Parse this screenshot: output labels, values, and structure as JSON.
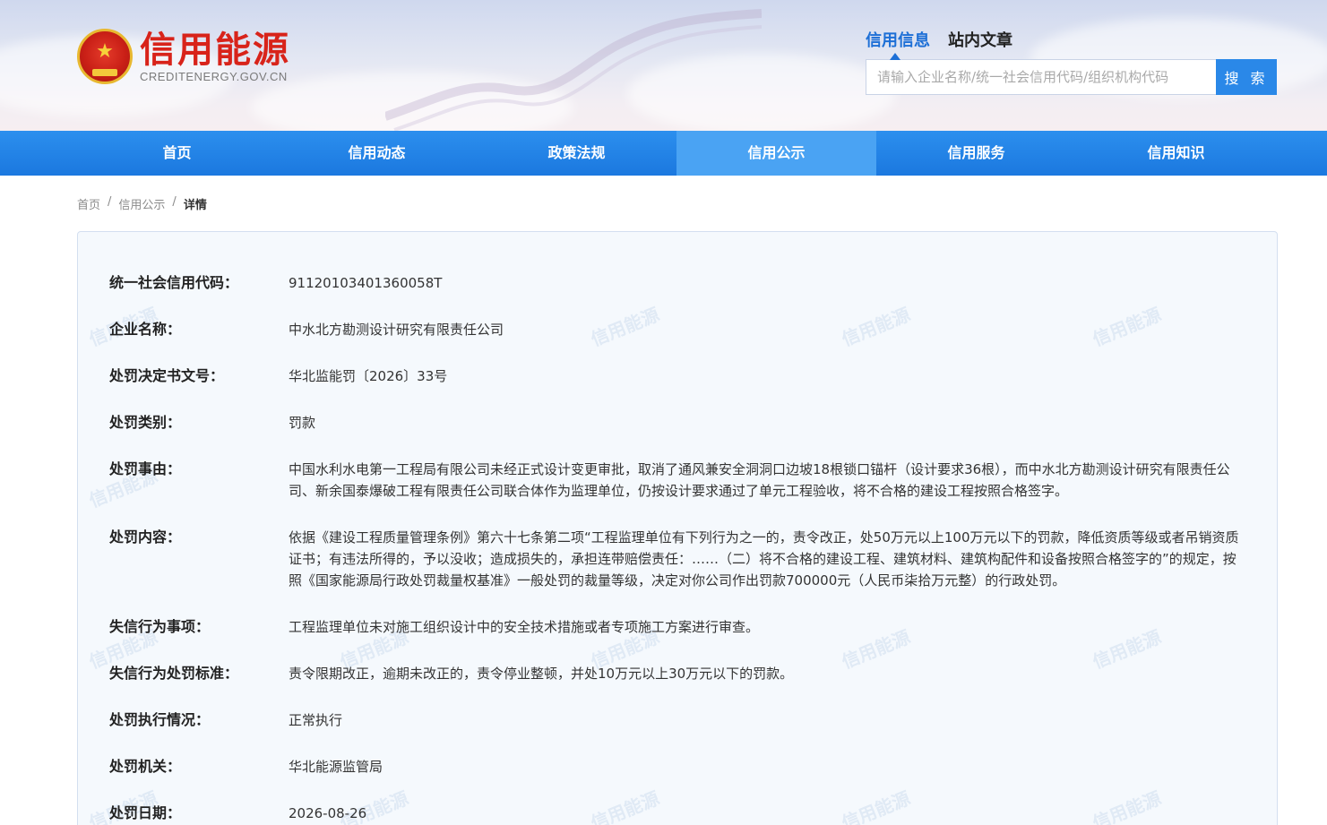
{
  "site": {
    "logo_cn": "信用能源",
    "logo_en": "CREDITENERGY.GOV.CN"
  },
  "search": {
    "tabs": [
      "信用信息",
      "站内文章"
    ],
    "active_tab": "信用信息",
    "placeholder": "请输入企业名称/统一社会信用代码/组织机构代码",
    "button": "搜 索"
  },
  "nav": {
    "items": [
      "首页",
      "信用动态",
      "政策法规",
      "信用公示",
      "信用服务",
      "信用知识"
    ],
    "active": "信用公示"
  },
  "breadcrumb": [
    "首页",
    "信用公示",
    "详情"
  ],
  "watermark": "信用能源",
  "detail": [
    {
      "label": "统一社会信用代码：",
      "value": "91120103401360058T"
    },
    {
      "label": "企业名称：",
      "value": "中水北方勘测设计研究有限责任公司"
    },
    {
      "label": "处罚决定书文号：",
      "value": "华北监能罚〔2026〕33号"
    },
    {
      "label": "处罚类别：",
      "value": "罚款"
    },
    {
      "label": "处罚事由：",
      "value": "中国水利水电第一工程局有限公司未经正式设计变更审批，取消了通风兼安全洞洞口边坡18根锁口锚杆（设计要求36根），而中水北方勘测设计研究有限责任公司、新余国泰爆破工程有限责任公司联合体作为监理单位，仍按设计要求通过了单元工程验收，将不合格的建设工程按照合格签字。"
    },
    {
      "label": "处罚内容：",
      "value": "依据《建设工程质量管理条例》第六十七条第二项“工程监理单位有下列行为之一的，责令改正，处50万元以上100万元以下的罚款，降低资质等级或者吊销资质证书；有违法所得的，予以没收；造成损失的，承担连带赔偿责任：……（二）将不合格的建设工程、建筑材料、建筑构配件和设备按照合格签字的”的规定，按照《国家能源局行政处罚裁量权基准》一般处罚的裁量等级，决定对你公司作出罚款700000元（人民币柒拾万元整）的行政处罚。"
    },
    {
      "label": "失信行为事项：",
      "value": "工程监理单位未对施工组织设计中的安全技术措施或者专项施工方案进行审查。"
    },
    {
      "label": "失信行为处罚标准：",
      "value": "责令限期改正，逾期未改正的，责令停业整顿，并处10万元以上30万元以下的罚款。"
    },
    {
      "label": "处罚执行情况：",
      "value": "正常执行"
    },
    {
      "label": "处罚机关：",
      "value": "华北能源监管局"
    },
    {
      "label": "处罚日期：",
      "value": "2026-08-26"
    }
  ]
}
